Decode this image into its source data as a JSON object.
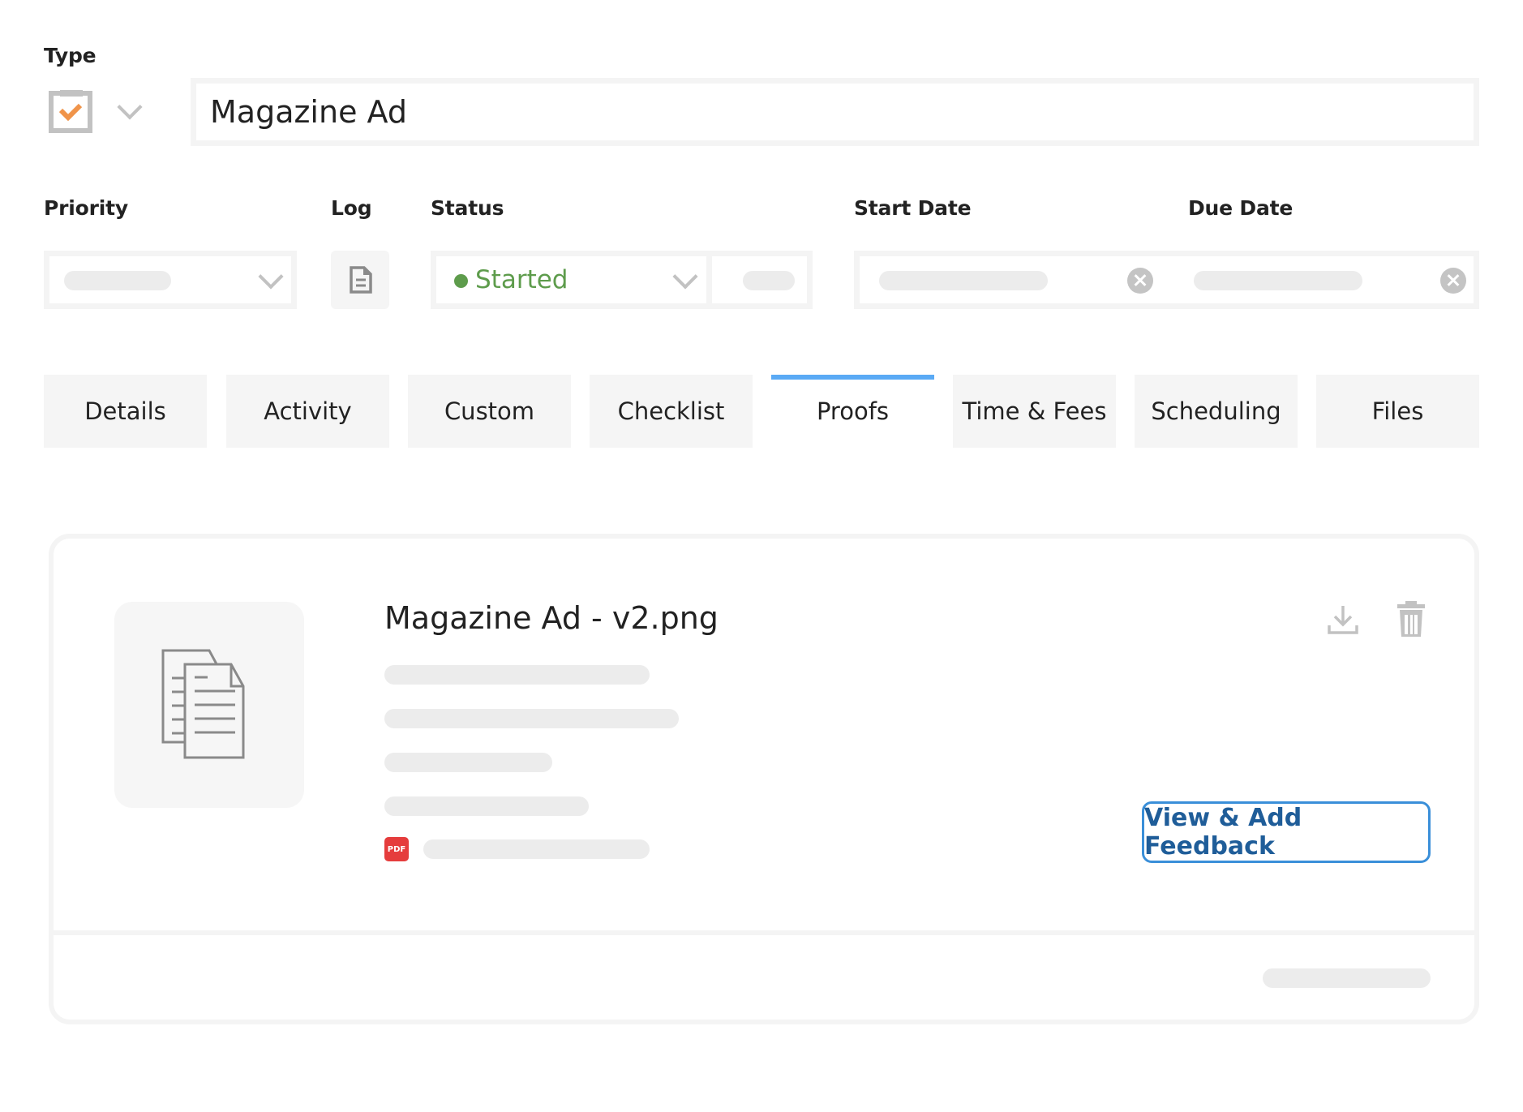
{
  "type_section": {
    "label": "Type",
    "type_icon": "clipboard-check-icon",
    "title_value": "Magazine Ad"
  },
  "fields": {
    "priority_label": "Priority",
    "log_label": "Log",
    "status_label": "Status",
    "status_value": "Started",
    "status_color": "#5e9c4c",
    "start_date_label": "Start Date",
    "due_date_label": "Due Date"
  },
  "tabs": [
    {
      "label": "Details",
      "active": false
    },
    {
      "label": "Activity",
      "active": false
    },
    {
      "label": "Custom",
      "active": false
    },
    {
      "label": "Checklist",
      "active": false
    },
    {
      "label": "Proofs",
      "active": true
    },
    {
      "label": "Time & Fees",
      "active": false
    },
    {
      "label": "Scheduling",
      "active": false
    },
    {
      "label": "Files",
      "active": false
    }
  ],
  "proof": {
    "filename": "Magazine Ad - v2.png",
    "file_badge": "PDF",
    "feedback_button": "View & Add Feedback"
  },
  "colors": {
    "accent_tab": "#5aaaf5",
    "button_border": "#3a8fd9",
    "button_text": "#1f5d99",
    "type_check": "#f0944a",
    "pdf_badge": "#e53c3c"
  }
}
